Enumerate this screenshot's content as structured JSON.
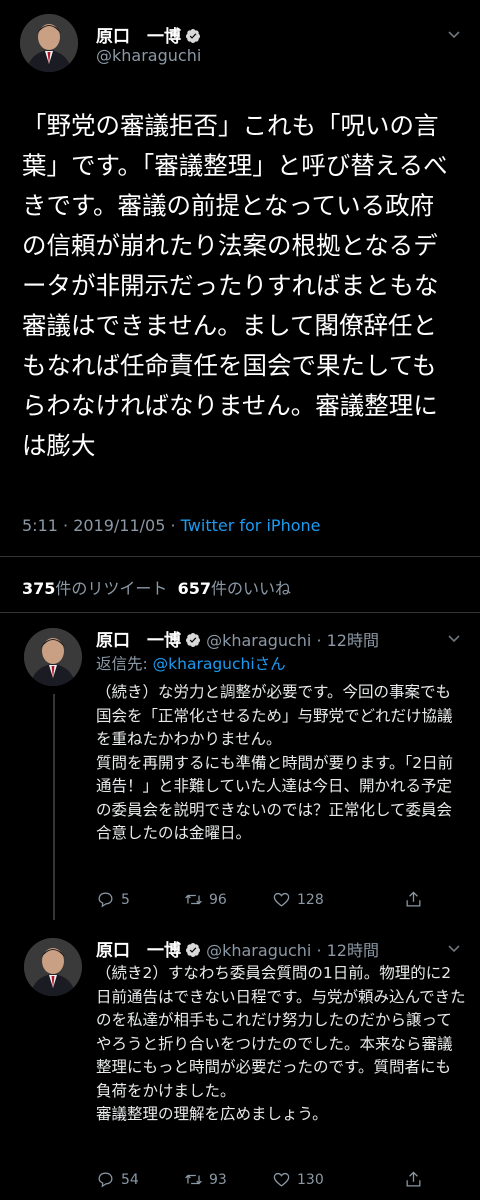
{
  "main_tweet": {
    "author_name": "原口　一博",
    "handle": "@kharaguchi",
    "text": "「野党の審議拒否」これも「呪いの言葉」です。「審議整理」と呼び替えるべきです。審議の前提となっている政府の信頼が崩れたり法案の根拠となるデータが非開示だったりすればまともな審議はできません。まして閣僚辞任ともなれば任命責任を国会で果たしてもらわなければなりません。審議整理には膨大",
    "time_date": "5:11 · 2019/11/05 · ",
    "source": "Twitter for iPhone",
    "retweets_count": "375",
    "retweets_label": "件のリツイート",
    "likes_count": "657",
    "likes_label": "件のいいね"
  },
  "replies": [
    {
      "author_name": "原口　一博",
      "handle_time": "@kharaguchi · 12時間",
      "reply_to_prefix": "返信先: ",
      "reply_to_handle": "@kharaguchiさん",
      "text": "（続き）な労力と調整が必要です。今回の事案でも国会を「正常化させるため」与野党でどれだけ協議を重ねたかわかりません。\n質問を再開するにも準備と時間が要ります。「2日前通告！」と非難していた人達は今日、開かれる予定の委員会を説明できないのでは？正常化して委員会合意したのは金曜日。",
      "replies": "5",
      "retweets": "96",
      "likes": "128"
    },
    {
      "author_name": "原口　一博",
      "handle_time": "@kharaguchi · 12時間",
      "text": "（続き2）すなわち委員会質問の1日前。物理的に2日前通告はできない日程です。与党が頼み込んできたのを私達が相手もこれだけ努力したのだから譲ってやろうと折り合いをつけたのでした。本来なら審議整理にもっと時間が必要だったのです。質問者にも負荷をかけました。\n審議整理の理解を広めましょう。",
      "replies": "54",
      "retweets": "93",
      "likes": "130"
    }
  ],
  "colors": {
    "background": "#000000",
    "accent": "#1d9bf0",
    "secondary_text": "#8b98a5",
    "divider": "#2f3336"
  },
  "icons": [
    "verified-badge-icon",
    "chevron-down-icon",
    "reply-icon",
    "retweet-icon",
    "like-icon",
    "share-icon"
  ]
}
